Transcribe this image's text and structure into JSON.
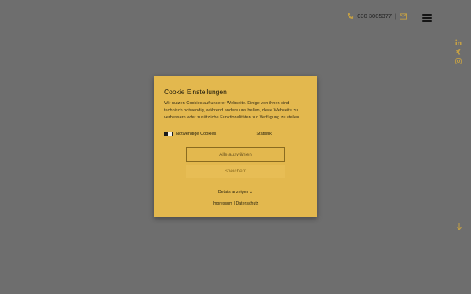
{
  "header": {
    "phone": "030 3005377",
    "separator": "|",
    "icons": {
      "phone": "phone-icon",
      "mail": "mail-icon",
      "menu": "hamburger-menu-icon"
    }
  },
  "social": {
    "icons": [
      "linkedin-icon",
      "xing-icon",
      "instagram-icon"
    ],
    "scroll_icon": "arrow-down-icon"
  },
  "cookie_modal": {
    "title": "Cookie Einstellungen",
    "text": "Wir nutzen Cookies auf unserer Webseite. Einige von ihnen sind technisch notwendig, während andere uns helfen, diese Webseite zu verbessern oder zusätzliche Funktionalitäten zur Verfügung zu stellen.",
    "options": [
      {
        "label": "Notwendige Cookies",
        "checked": true
      },
      {
        "label": "Statistik",
        "checked": false
      }
    ],
    "accept_all_label": "Alle auswählen",
    "save_label": "Speichern",
    "details_label": "Details anzeigen",
    "details_chevron": "⌄",
    "impressum_label": "Impressum",
    "link_separator": "|",
    "datenschutz_label": "Datenschutz"
  },
  "colors": {
    "overlay": "#6e6e6e",
    "modal_bg": "#e3b84e",
    "accent": "#d4b25a"
  }
}
